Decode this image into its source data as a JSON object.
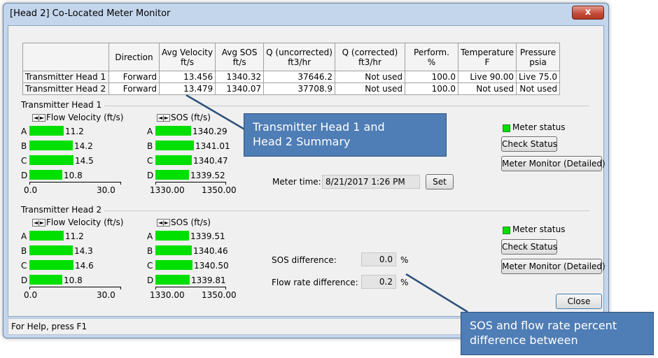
{
  "window": {
    "title": "[Head 2] Co-Located Meter Monitor",
    "close_glyph": "x"
  },
  "table": {
    "headers": [
      {
        "l1": "Direction",
        "l2": ""
      },
      {
        "l1": "Avg Velocity",
        "l2": "ft/s"
      },
      {
        "l1": "Avg SOS",
        "l2": "ft/s"
      },
      {
        "l1": "Q (uncorrected)",
        "l2": "ft3/hr"
      },
      {
        "l1": "Q (corrected)",
        "l2": "ft3/hr"
      },
      {
        "l1": "Perform.",
        "l2": "%"
      },
      {
        "l1": "Temperature",
        "l2": "F"
      },
      {
        "l1": "Pressure",
        "l2": "psia"
      }
    ],
    "rows": [
      {
        "name": "Transmitter Head 1",
        "cells": [
          "Forward",
          "13.456",
          "1340.32",
          "37646.2",
          "Not used",
          "100.0",
          "Live 90.00",
          "Live 75.0"
        ]
      },
      {
        "name": "Transmitter Head 2",
        "cells": [
          "Forward",
          "13.479",
          "1340.07",
          "37708.9",
          "Not used",
          "100.0",
          "Not used",
          "Not used"
        ]
      }
    ]
  },
  "head1": {
    "group_label": "Transmitter Head 1",
    "flow_label": "Flow Velocity (ft/s)",
    "sos_label": "SOS (ft/s)",
    "flow_paths": [
      {
        "path": "A",
        "value": "11.2"
      },
      {
        "path": "B",
        "value": "14.2"
      },
      {
        "path": "C",
        "value": "14.5"
      },
      {
        "path": "D",
        "value": "10.8"
      }
    ],
    "sos_paths": [
      {
        "path": "A",
        "value": "1340.29"
      },
      {
        "path": "B",
        "value": "1341.01"
      },
      {
        "path": "C",
        "value": "1340.47"
      },
      {
        "path": "D",
        "value": "1339.52"
      }
    ],
    "flow_axis": {
      "min": "0.0",
      "max": "30.0"
    },
    "sos_axis": {
      "min": "1330.00",
      "max": "1350.00"
    },
    "meter_status": "Meter status",
    "check_status": "Check Status",
    "meter_monitor": "Meter Monitor (Detailed)",
    "meter_time_label": "Meter time:",
    "meter_time_value": "8/21/2017 1:26 PM",
    "set_button": "Set"
  },
  "head2": {
    "group_label": "Transmitter Head 2",
    "flow_label": "Flow Velocity (ft/s)",
    "sos_label": "SOS (ft/s)",
    "flow_paths": [
      {
        "path": "A",
        "value": "11.2"
      },
      {
        "path": "B",
        "value": "14.3"
      },
      {
        "path": "C",
        "value": "14.6"
      },
      {
        "path": "D",
        "value": "10.8"
      }
    ],
    "sos_paths": [
      {
        "path": "A",
        "value": "1339.51"
      },
      {
        "path": "B",
        "value": "1340.46"
      },
      {
        "path": "C",
        "value": "1340.50"
      },
      {
        "path": "D",
        "value": "1339.81"
      }
    ],
    "flow_axis": {
      "min": "0.0",
      "max": "30.0"
    },
    "sos_axis": {
      "min": "1330.00",
      "max": "1350.00"
    },
    "meter_status": "Meter status",
    "check_status": "Check Status",
    "meter_monitor": "Meter Monitor (Detailed)"
  },
  "differences": {
    "sos_label": "SOS difference:",
    "sos_value": "0.0",
    "flow_label": "Flow rate difference:",
    "flow_value": "0.2",
    "unit": "%"
  },
  "close_button": "Close",
  "status_bar": "For Help, press F1",
  "callouts": {
    "summary": [
      "Transmitter Head 1 and",
      "Head 2 Summary"
    ],
    "difference": [
      "SOS and flow rate percent",
      "difference between"
    ]
  },
  "colors": {
    "bar": "#00e000",
    "callout_bg": "#4f7db5"
  }
}
